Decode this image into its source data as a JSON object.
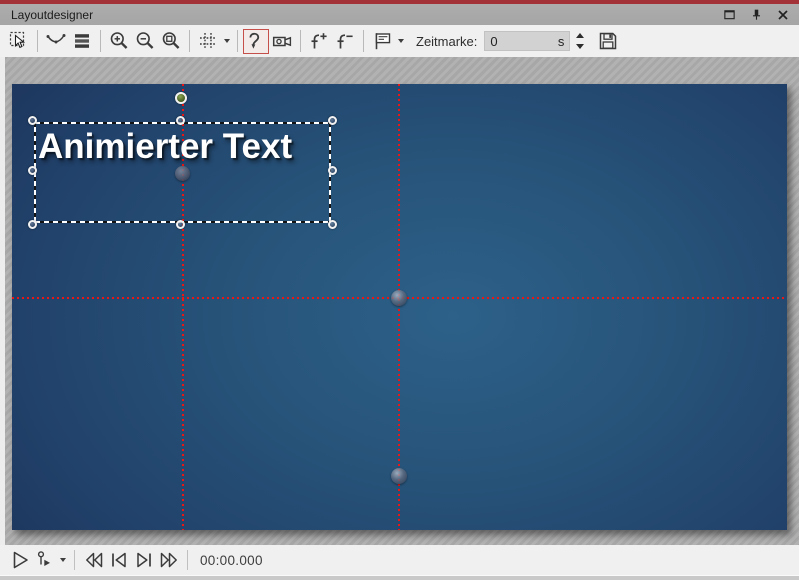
{
  "window": {
    "title": "Layoutdesigner",
    "controls": [
      "maximize",
      "pin",
      "close"
    ]
  },
  "colors": {
    "accent_red": "#a23237",
    "active_tool_border": "#c5504a",
    "guide_red": "#ee1414",
    "canvas_gradient_center": "#2d6189",
    "canvas_gradient_edge": "#182b4d",
    "rotation_handle_green": "#6b8a3c",
    "selection_handle_ring": "#f2f2f2"
  },
  "toolbar": {
    "tools": [
      "selection-tool",
      "smooth-curve-tool",
      "layer-list",
      "zoom-in",
      "zoom-out",
      "zoom-reset",
      "grid-settings",
      "motion-path-tool",
      "camera-pan",
      "add-curve-point",
      "remove-curve-point",
      "timemark-menu",
      "save"
    ],
    "active_tool": "motion-path-tool",
    "zeitmarke": {
      "label": "Zeitmarke:",
      "value": "0",
      "unit": "s"
    }
  },
  "icons": [
    "selection-tool-icon",
    "smooth-curve-icon",
    "layers-icon",
    "zoom-in-icon",
    "zoom-out-icon",
    "zoom-reset-icon",
    "grid-icon",
    "dropdown-caret-icon",
    "motion-path-icon",
    "camera-icon",
    "add-keyframe-icon",
    "remove-keyframe-icon",
    "timemark-flag-icon",
    "save-icon",
    "maximize-icon",
    "pin-icon",
    "close-icon",
    "play-icon",
    "play-from-timemark-icon",
    "skip-start-icon",
    "prev-keyframe-icon",
    "next-keyframe-icon",
    "skip-end-icon"
  ],
  "canvas": {
    "text_element": {
      "text": "Animierter Text",
      "selected": true
    },
    "guides": {
      "vertical_count": 2,
      "horizontal_count": 1
    }
  },
  "playbar": {
    "buttons": [
      "play",
      "play-from-timemark",
      "skip-to-start",
      "previous-keyframe",
      "next-keyframe",
      "skip-to-end"
    ],
    "time": "00:00.000"
  }
}
